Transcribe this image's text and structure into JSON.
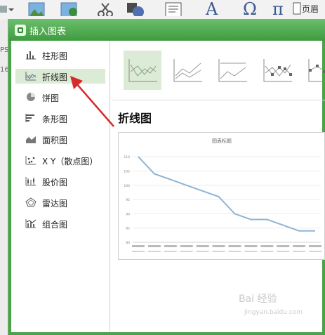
{
  "ribbon": {
    "omega": "Ω",
    "pi": "π",
    "page_label": "页眉"
  },
  "sheet_strip": {
    "row_label_1": "PS",
    "row_label_2": "16"
  },
  "dialog": {
    "title": "插入图表",
    "categories": [
      {
        "icon": "column-chart-icon",
        "label": "柱形图"
      },
      {
        "icon": "line-chart-icon",
        "label": "折线图"
      },
      {
        "icon": "pie-chart-icon",
        "label": "饼图"
      },
      {
        "icon": "bar-chart-icon",
        "label": "条形图"
      },
      {
        "icon": "area-chart-icon",
        "label": "面积图"
      },
      {
        "icon": "scatter-chart-icon",
        "label": "X Y（散点图）"
      },
      {
        "icon": "stock-chart-icon",
        "label": "股价图"
      },
      {
        "icon": "radar-chart-icon",
        "label": "雷达图"
      },
      {
        "icon": "combo-chart-icon",
        "label": "组合图"
      }
    ],
    "selected_category": "折线图",
    "subtype_heading": "折线图",
    "subtypes": [
      "line",
      "stacked-line",
      "percent-stacked-line",
      "line-with-markers",
      "stacked-line-with-markers"
    ]
  },
  "chart_data": {
    "type": "line",
    "title": "图表标题",
    "ylim": [
      80,
      112
    ],
    "yticks": [
      80,
      85,
      90,
      95,
      100,
      105,
      110
    ],
    "values": [
      110,
      104,
      102,
      100,
      98,
      96,
      90,
      88,
      88,
      86,
      84,
      84
    ],
    "line_color": "#8fb4d4"
  },
  "annotation": {
    "arrow_color": "#d62b2b"
  },
  "watermark": {
    "main": "Bai 经验",
    "sub": "jingyan.baidu.com"
  }
}
